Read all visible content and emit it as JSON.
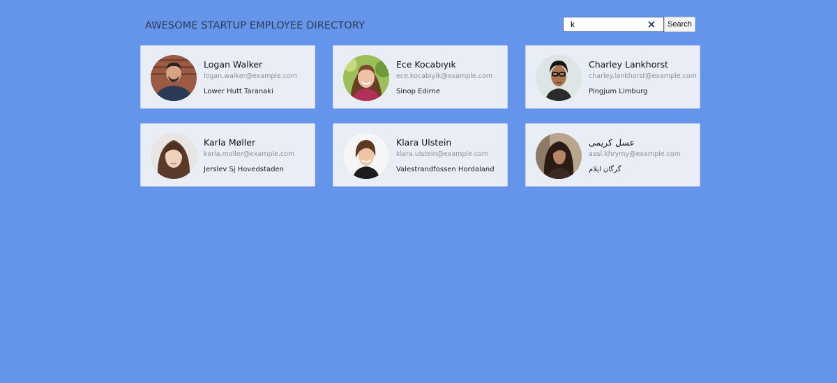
{
  "header": {
    "title": "AWESOME STARTUP EMPLOYEE DIRECTORY"
  },
  "search": {
    "value": "k",
    "button_label": "Search"
  },
  "employees": [
    {
      "name": "Logan Walker",
      "email": "logan.walker@example.com",
      "location": "Lower Hutt Taranaki"
    },
    {
      "name": "Ece Kocabıyık",
      "email": "ece.kocabiyik@example.com",
      "location": "Sinop Edirne"
    },
    {
      "name": "Charley Lankhorst",
      "email": "charley.lankhorst@example.com",
      "location": "Pingjum Limburg"
    },
    {
      "name": "Karla Møller",
      "email": "karla.moller@example.com",
      "location": "Jerslev Sj Hovedstaden"
    },
    {
      "name": "Klara Ulstein",
      "email": "klara.ulstein@example.com",
      "location": "Valestrandfossen Hordaland"
    },
    {
      "name": "عسل کریمی",
      "email": "aasl.khrymy@example.com",
      "location": "گرگان ایلام"
    }
  ]
}
